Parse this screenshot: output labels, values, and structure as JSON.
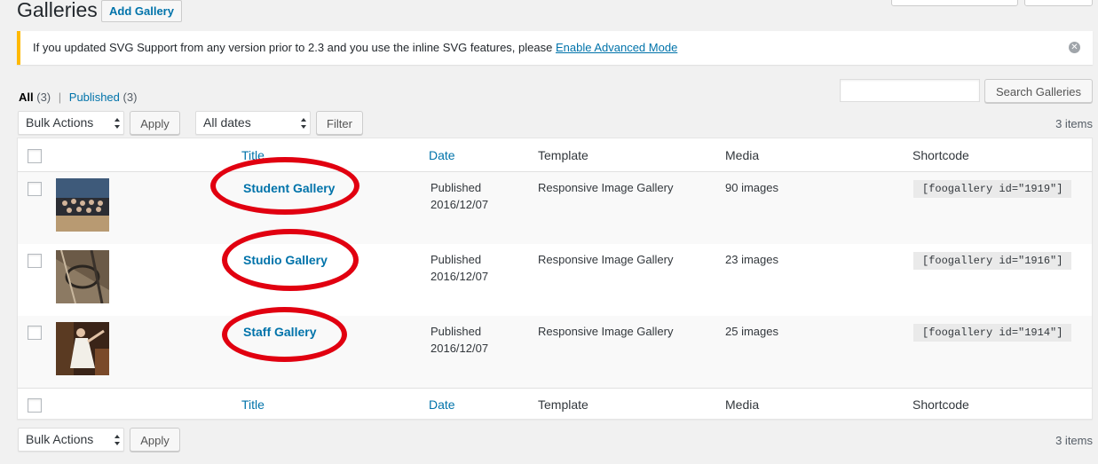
{
  "header": {
    "title": "Galleries",
    "add_button": "Add Gallery"
  },
  "notice": {
    "text": "If you updated SVG Support from any version prior to 2.3 and you use the inline SVG features, please ",
    "link": "Enable Advanced Mode",
    "dismiss_icon": "✕"
  },
  "views": {
    "all_label": "All",
    "all_count": "(3)",
    "separator": "|",
    "published_label": "Published",
    "published_count": "(3)"
  },
  "search": {
    "value": "",
    "button": "Search Galleries"
  },
  "tablenav_top": {
    "bulk_actions": "Bulk Actions",
    "apply": "Apply",
    "dates": "All dates",
    "filter": "Filter",
    "items": "3 items"
  },
  "columns": {
    "title": "Title",
    "date": "Date",
    "template": "Template",
    "media": "Media",
    "shortcode": "Shortcode"
  },
  "rows": [
    {
      "title": "Student Gallery",
      "date_status": "Published",
      "date": "2016/12/07",
      "template": "Responsive Image Gallery",
      "media": "90 images",
      "shortcode": "[foogallery id=\"1919\"]"
    },
    {
      "title": "Studio Gallery",
      "date_status": "Published",
      "date": "2016/12/07",
      "template": "Responsive Image Gallery",
      "media": "23 images",
      "shortcode": "[foogallery id=\"1916\"]"
    },
    {
      "title": "Staff Gallery",
      "date_status": "Published",
      "date": "2016/12/07",
      "template": "Responsive Image Gallery",
      "media": "25 images",
      "shortcode": "[foogallery id=\"1914\"]"
    }
  ],
  "tablenav_bottom": {
    "bulk_actions": "Bulk Actions",
    "apply": "Apply",
    "items": "3 items"
  },
  "colors": {
    "link": "#0073aa",
    "notice_accent": "#ffb900",
    "annotation": "#e10010"
  }
}
